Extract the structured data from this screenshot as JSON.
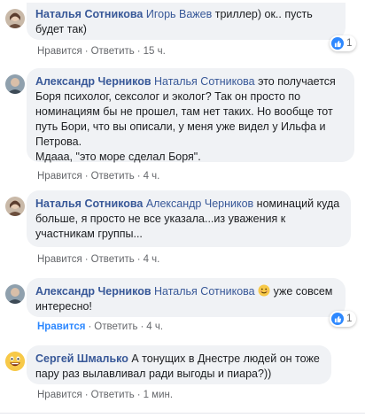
{
  "comments": [
    {
      "author": "Наталья Сотникова",
      "mention": "Игорь Важев",
      "text": " триллер) ок.. пусть будет так)",
      "like_label": "Нравится",
      "reply_label": "Ответить",
      "time": "15 ч.",
      "reactions": "1"
    },
    {
      "author": "Александр Черников",
      "mention": "Наталья Сотникова",
      "text": " это получается Боря психолог, сексолог и эколог? Так он просто по номинациям бы не прошел, там нет таких. Но вообще тот путь Бори, что вы описали, у меня уже видел у Ильфа и Петрова.",
      "text2": "Мдааа, \"это море сделал Боря\".",
      "like_label": "Нравится",
      "reply_label": "Ответить",
      "time": "4 ч."
    },
    {
      "author": "Наталья Сотникова",
      "mention": "Александр Черников",
      "text": " номинаций куда больше, я просто не все указала...из уважения к участникам группы...",
      "like_label": "Нравится",
      "reply_label": "Ответить",
      "time": "4 ч."
    },
    {
      "author": "Александр Черников",
      "mention": "Наталья Сотникова",
      "text": " уже совсем интересно!",
      "like_label": "Нравится",
      "reply_label": "Ответить",
      "time": "4 ч.",
      "reactions": "1"
    },
    {
      "author": "Сергей Шмалько",
      "text": " А тонущих в Днестре людей он тоже пару раз вылавливал ради выгоды и пиара?))",
      "like_label": "Нравится",
      "reply_label": "Ответить",
      "time": "1 мин."
    }
  ],
  "icons": {
    "reaction": "thumbs-up-icon",
    "emoji": "smiling-face-emoji-icon"
  },
  "colors": {
    "link": "#385898",
    "bubble": "#f0f2f5",
    "like_active": "#2d88ff"
  }
}
